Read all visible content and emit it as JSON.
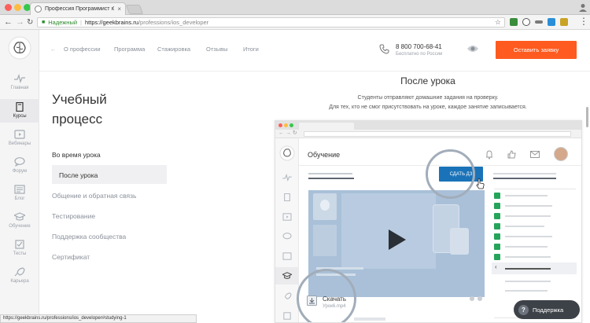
{
  "browser": {
    "tab_title": "Профессия Программист iOS",
    "tab_close": "×",
    "url_secure_label": "Надежный",
    "url_host": "https://geekbrains.ru",
    "url_path": "/professions/ios_developer",
    "status_url": "https://geekbrains.ru/professions/ios_developer#studying-1"
  },
  "sidebar": {
    "items": [
      {
        "label": "Главная",
        "icon": "pulse-icon"
      },
      {
        "label": "Курсы",
        "icon": "book-icon"
      },
      {
        "label": "Вебинары",
        "icon": "video-icon"
      },
      {
        "label": "Форум",
        "icon": "chat-icon"
      },
      {
        "label": "Блог",
        "icon": "newspaper-icon"
      },
      {
        "label": "Обучение",
        "icon": "graduation-cap-icon"
      },
      {
        "label": "Тесты",
        "icon": "checkbox-icon"
      },
      {
        "label": "Карьера",
        "icon": "rocket-icon"
      }
    ]
  },
  "nav": {
    "links": [
      "О профессии",
      "Программа",
      "Стажировка",
      "Отзывы",
      "Итоги"
    ],
    "phone": "8 800 700-68-41",
    "phone_note": "Бесплатно по России",
    "cta": "Оставить заявку"
  },
  "content": {
    "title_line1": "Учебный",
    "title_line2": "процесс",
    "menu": [
      "Во время урока",
      "После урока",
      "Общение и обратная связь",
      "Тестирование",
      "Поддержка сообщества",
      "Сертификат"
    ],
    "section_title": "После урока",
    "sub1": "Студенты отправляют домашние задания на проверку.",
    "sub2": "Для тех, кто не смог присутствовать на уроке, каждое занятие записывается."
  },
  "mockup": {
    "page_title": "Обучение",
    "submit_button": "СДАТЬ ДЗ",
    "download_label": "Скачать",
    "download_file": "Урок6.mp4"
  },
  "support": {
    "label": "Поддержка",
    "icon_glyph": "?"
  },
  "colors": {
    "cta": "#ff5a1f",
    "mock_button": "#1a73b8",
    "check": "#25a55a"
  }
}
